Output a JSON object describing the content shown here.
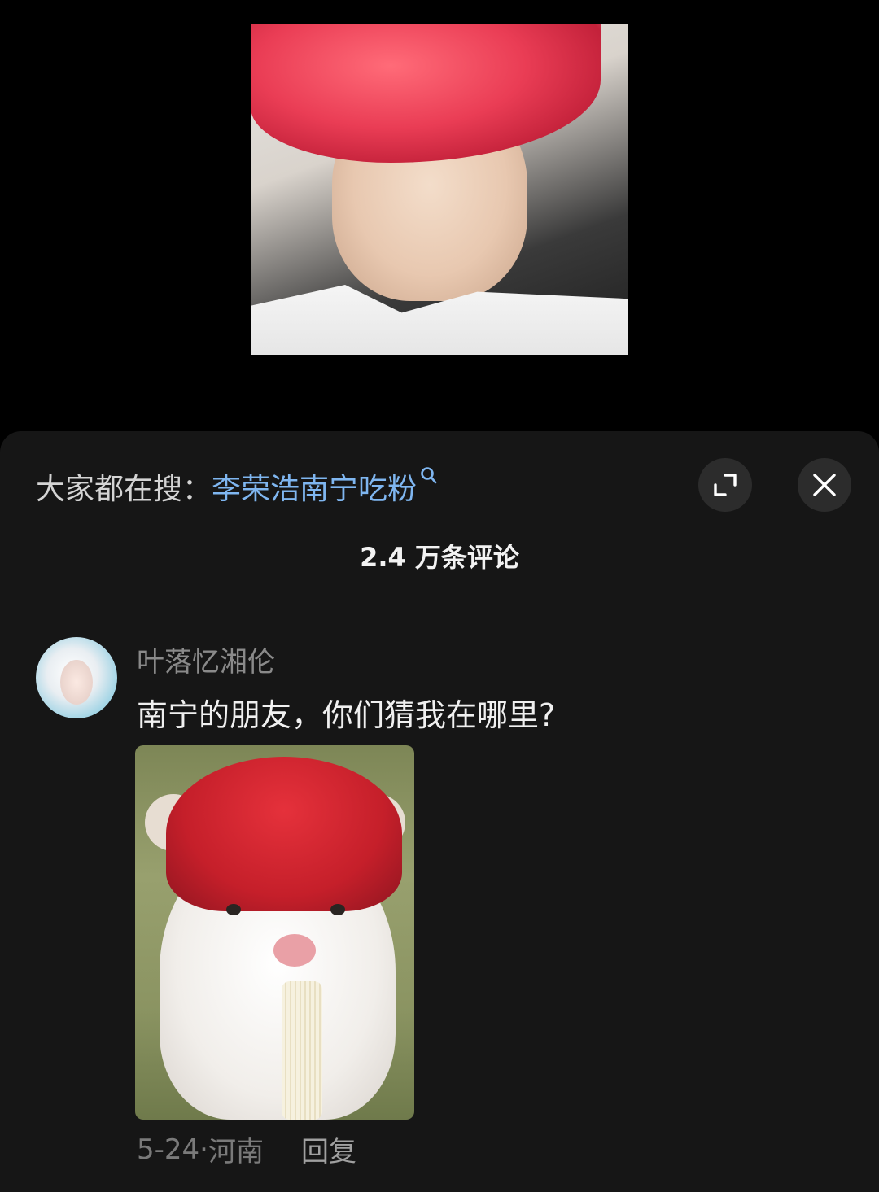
{
  "search_tip": {
    "prefix": "大家都在搜：",
    "keyword": "李荣浩南宁吃粉",
    "icon": "search-icon"
  },
  "buttons": {
    "expand_icon": "expand-icon",
    "close_icon": "close-icon"
  },
  "comment_count": "2.4 万条评论",
  "comment": {
    "username": "叶落忆湘伦",
    "text": "南宁的朋友，你们猜我在哪里?",
    "date": "5-24",
    "separator": "·",
    "location": "河南",
    "reply_label": "回复"
  },
  "colors": {
    "sheet_bg": "#161616",
    "keyword": "#7fb6f0",
    "username": "#8a8a8a"
  }
}
